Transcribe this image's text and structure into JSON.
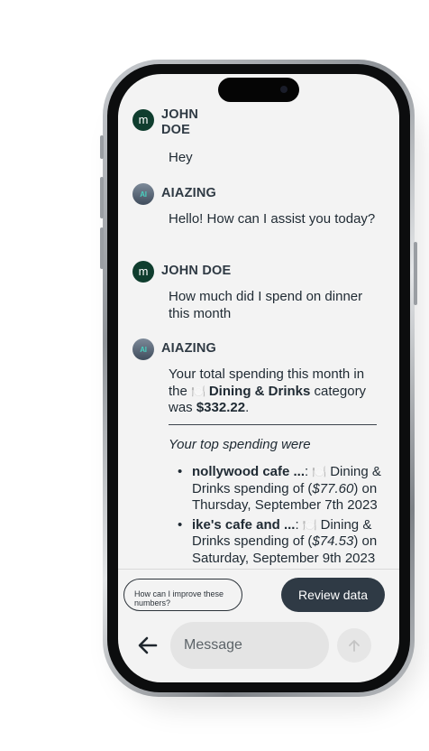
{
  "messages": [
    {
      "sender": "JOHN\nDOE",
      "avatar_letter": "m",
      "text": "Hey"
    },
    {
      "sender": "AIAZING",
      "avatar_label": "AI",
      "text": "Hello! How can I assist you today?"
    },
    {
      "sender": "JOHN DOE",
      "avatar_letter": "m",
      "text": "How much did I spend on dinner this month"
    },
    {
      "sender": "AIAZING",
      "avatar_label": "AI",
      "summary_prefix": "Your total spending this month in the ",
      "category_icon": "plate-cutlery-icon",
      "category": "Dining & Drinks",
      "summary_mid": " category was ",
      "total": "$332.22",
      "summary_end": ".",
      "top_heading": "Your top spending were",
      "top_items": [
        {
          "merchant": "nollywood cafe ...",
          "category": "Dining & Drinks",
          "pre_amount": " spending of (",
          "amount": "$77.60",
          "post_amount": ") on Thursday, September 7th 2023"
        },
        {
          "merchant": "ike's cafe and ...",
          "category": "Dining & Drinks",
          "pre_amount": " spending of (",
          "amount": "$74.53",
          "post_amount": ") on Saturday, September 9th 2023"
        }
      ]
    }
  ],
  "suggestion": "How can I improve these numbers?",
  "review_button": "Review data",
  "composer": {
    "placeholder": "Message",
    "back_icon": "arrow-left-icon",
    "send_icon": "arrow-up-icon"
  },
  "colors": {
    "user_avatar": "#0f3d2e",
    "button_dark": "#2f3a45",
    "screen_bg": "#f3f3f3"
  }
}
